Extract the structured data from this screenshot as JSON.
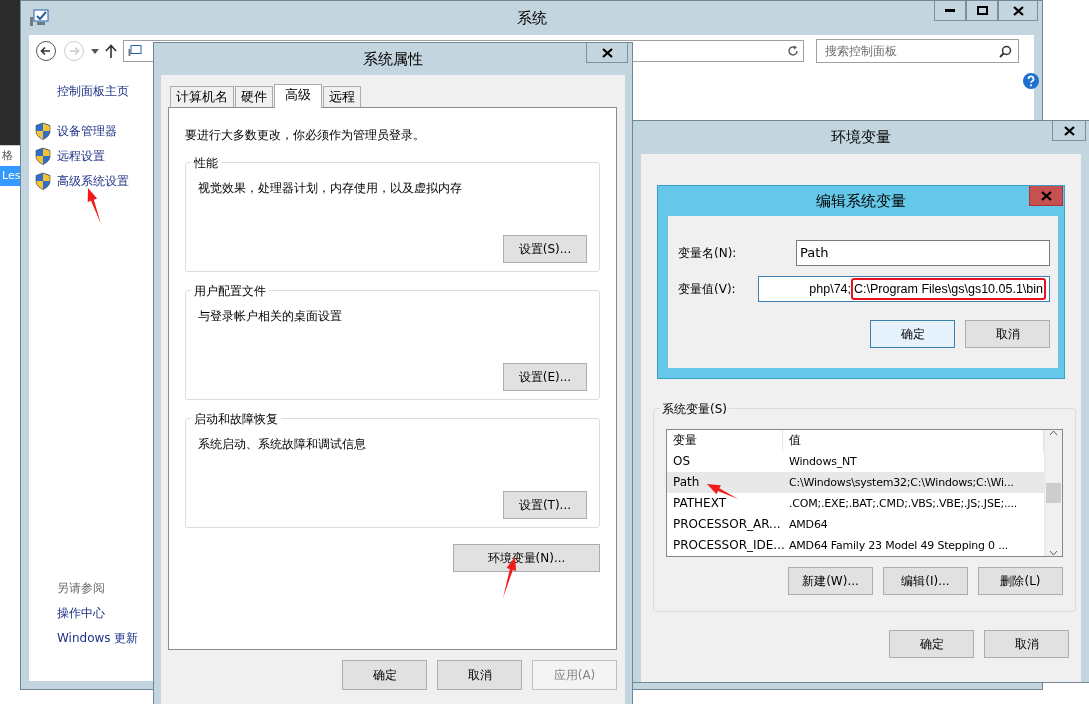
{
  "background_window": {
    "items": [
      {
        "text": "格",
        "selected": false
      },
      {
        "text": "Les",
        "selected": true
      }
    ]
  },
  "system_window": {
    "title": "系统",
    "search": {
      "placeholder": "搜索控制面板"
    },
    "sidebar": {
      "home": "控制面板主页",
      "items": [
        {
          "label": "设备管理器"
        },
        {
          "label": "远程设置"
        },
        {
          "label": "高级系统设置"
        }
      ],
      "see_also": {
        "heading": "另请参阅",
        "links": [
          "操作中心",
          "Windows 更新"
        ]
      }
    }
  },
  "system_properties": {
    "title": "系统属性",
    "tabs": [
      {
        "label": "计算机名",
        "selected": false
      },
      {
        "label": "硬件",
        "selected": false
      },
      {
        "label": "高级",
        "selected": true
      },
      {
        "label": "远程",
        "selected": false
      }
    ],
    "notice": "要进行大多数更改，你必须作为管理员登录。",
    "groups": [
      {
        "title": "性能",
        "description": "视觉效果，处理器计划，内存使用，以及虚拟内存",
        "button": "设置(S)..."
      },
      {
        "title": "用户配置文件",
        "description": "与登录帐户相关的桌面设置",
        "button": "设置(E)..."
      },
      {
        "title": "启动和故障恢复",
        "description": "系统启动、系统故障和调试信息",
        "button": "设置(T)..."
      }
    ],
    "env_button": "环境变量(N)...",
    "buttons": [
      {
        "label": "确定",
        "disabled": false
      },
      {
        "label": "取消",
        "disabled": false
      },
      {
        "label": "应用(A)",
        "disabled": true
      }
    ]
  },
  "environment_variables": {
    "title": "环境变量",
    "system_vars": {
      "title": "系统变量(S)",
      "columns": [
        "变量",
        "值"
      ],
      "rows": [
        {
          "name": "OS",
          "value": "Windows_NT",
          "selected": false
        },
        {
          "name": "Path",
          "value": "C:\\Windows\\system32;C:\\Windows;C:\\Wi...",
          "selected": true
        },
        {
          "name": "PATHEXT",
          "value": ".COM;.EXE;.BAT;.CMD;.VBS;.VBE;.JS;.JSE;....",
          "selected": false
        },
        {
          "name": "PROCESSOR_AR...",
          "value": "AMD64",
          "selected": false
        },
        {
          "name": "PROCESSOR_IDE...",
          "value": "AMD64 Family 23 Model 49 Stepping 0 ...",
          "selected": false
        }
      ],
      "buttons": [
        "新建(W)...",
        "编辑(I)...",
        "删除(L)"
      ]
    },
    "buttons": [
      "确定",
      "取消"
    ]
  },
  "edit_dialog": {
    "title": "编辑系统变量",
    "fields": [
      {
        "label": "变量名(N):",
        "value_parts": [
          {
            "text": "Path",
            "highlighted": false
          }
        ]
      },
      {
        "label": "变量值(V):",
        "value_parts": [
          {
            "text": "php\\74;",
            "highlighted": false
          },
          {
            "text": "C:\\Program Files\\gs\\gs10.05.1\\bin",
            "highlighted": true
          }
        ]
      }
    ],
    "buttons": [
      {
        "label": "确定",
        "default": true
      },
      {
        "label": "取消",
        "default": false
      }
    ]
  }
}
